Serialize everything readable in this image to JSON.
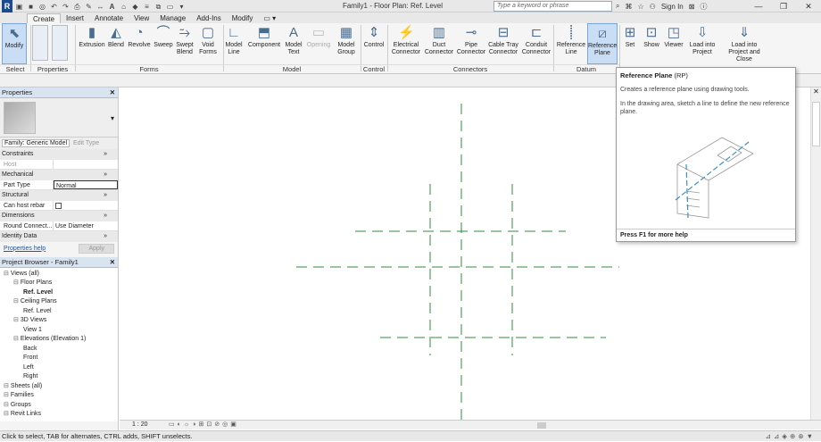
{
  "title_bar": {
    "document_title": "Family1 - Floor Plan: Ref. Level",
    "search_placeholder": "Type a keyword or phrase",
    "sign_in": "Sign In"
  },
  "tabs": [
    "Create",
    "Insert",
    "Annotate",
    "View",
    "Manage",
    "Add-Ins",
    "Modify"
  ],
  "ribbon": {
    "buttons": [
      {
        "name": "modify",
        "label": "Modify",
        "icon": "cursor-icon"
      },
      {
        "name": "extrusion",
        "label": "Extrusion",
        "icon": "extrusion-icon"
      },
      {
        "name": "blend",
        "label": "Blend",
        "icon": "blend-icon"
      },
      {
        "name": "revolve",
        "label": "Revolve",
        "icon": "revolve-icon"
      },
      {
        "name": "sweep",
        "label": "Sweep",
        "icon": "sweep-icon"
      },
      {
        "name": "swept-blend",
        "label": "Swept Blend",
        "icon": "swept-blend-icon"
      },
      {
        "name": "void-forms",
        "label": "Void Forms",
        "icon": "void-icon"
      },
      {
        "name": "model-line",
        "label": "Model Line",
        "icon": "model-line-icon"
      },
      {
        "name": "component",
        "label": "Component",
        "icon": "component-icon"
      },
      {
        "name": "model-text",
        "label": "Model Text",
        "icon": "text-icon"
      },
      {
        "name": "opening",
        "label": "Opening",
        "icon": "opening-icon"
      },
      {
        "name": "model-group",
        "label": "Model Group",
        "icon": "group-icon"
      },
      {
        "name": "control",
        "label": "Control",
        "icon": "control-icon"
      },
      {
        "name": "electrical-connector",
        "label": "Electrical Connector",
        "icon": "electrical-icon"
      },
      {
        "name": "duct-connector",
        "label": "Duct Connector",
        "icon": "duct-icon"
      },
      {
        "name": "pipe-connector",
        "label": "Pipe Connector",
        "icon": "pipe-icon"
      },
      {
        "name": "cable-tray-connector",
        "label": "Cable Tray Connector",
        "icon": "cable-tray-icon"
      },
      {
        "name": "conduit-connector",
        "label": "Conduit Connector",
        "icon": "conduit-icon"
      },
      {
        "name": "reference-line",
        "label": "Reference Line",
        "icon": "reference-line-icon"
      },
      {
        "name": "reference-plane",
        "label": "Reference Plane",
        "icon": "reference-plane-icon"
      },
      {
        "name": "set",
        "label": "Set",
        "icon": "grid-icon"
      },
      {
        "name": "show",
        "label": "Show",
        "icon": "show-icon"
      },
      {
        "name": "viewer",
        "label": "Viewer",
        "icon": "viewer-icon"
      },
      {
        "name": "load-into-project",
        "label": "Load into Project",
        "icon": "load-icon"
      },
      {
        "name": "load-into-project-close",
        "label": "Load into Project and Close",
        "icon": "load-close-icon"
      }
    ],
    "panels": [
      "Select",
      "Properties",
      "Forms",
      "Model",
      "Control",
      "Connectors",
      "Datum"
    ]
  },
  "properties_panel": {
    "title": "Properties",
    "family": "Family: Generic Model",
    "edit_type": "Edit Type",
    "groups": [
      {
        "name": "Constraints",
        "rows": [
          {
            "k": "Host",
            "v": ""
          }
        ]
      },
      {
        "name": "Mechanical",
        "rows": [
          {
            "k": "Part Type",
            "v": "Normal"
          }
        ]
      },
      {
        "name": "Structural",
        "rows": [
          {
            "k": "Can host rebar",
            "v": ""
          }
        ]
      },
      {
        "name": "Dimensions",
        "rows": [
          {
            "k": "Round Connect...",
            "v": "Use Diameter"
          }
        ]
      },
      {
        "name": "Identity Data",
        "rows": []
      }
    ],
    "help_link": "Properties help",
    "apply": "Apply"
  },
  "project_browser": {
    "title": "Project Browser - Family1",
    "items": [
      {
        "label": "Views (all)",
        "level": 0
      },
      {
        "label": "Floor Plans",
        "level": 1
      },
      {
        "label": "Ref. Level",
        "level": 2,
        "bold": true
      },
      {
        "label": "Ceiling Plans",
        "level": 1
      },
      {
        "label": "Ref. Level",
        "level": 2
      },
      {
        "label": "3D Views",
        "level": 1
      },
      {
        "label": "View 1",
        "level": 2
      },
      {
        "label": "Elevations (Elevation 1)",
        "level": 1
      },
      {
        "label": "Back",
        "level": 2
      },
      {
        "label": "Front",
        "level": 2
      },
      {
        "label": "Left",
        "level": 2
      },
      {
        "label": "Right",
        "level": 2
      },
      {
        "label": "Sheets (all)",
        "level": 0
      },
      {
        "label": "Families",
        "level": 0
      },
      {
        "label": "Groups",
        "level": 0
      },
      {
        "label": "Revit Links",
        "level": 0
      }
    ]
  },
  "view_control": {
    "scale": "1 : 20"
  },
  "tooltip": {
    "title": "Reference Plane",
    "shortcut": "(RP)",
    "desc": "Creates a reference plane using drawing tools.",
    "detail": "In the drawing area, sketch a line to define the new reference plane.",
    "footer": "Press F1 for more help"
  },
  "status_bar": {
    "text": "Click to select, TAB for alternates, CTRL adds, SHIFT unselects."
  },
  "colors": {
    "ref_plane": "#2e8b3e",
    "accent": "#2d6fb8"
  }
}
